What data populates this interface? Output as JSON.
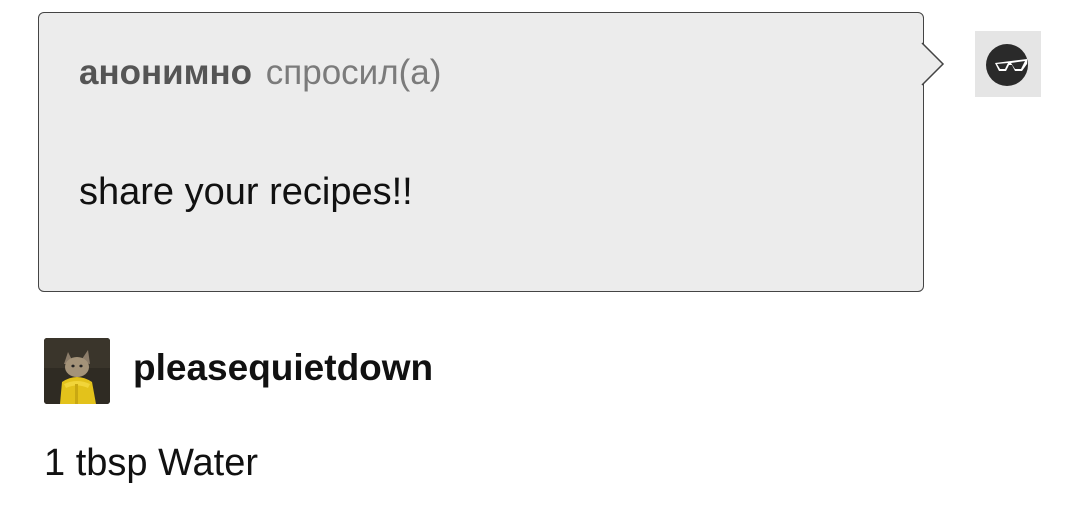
{
  "ask": {
    "asker": "анонимно",
    "verb": "спросил(а)",
    "question": "share your recipes!!",
    "anon_avatar_icon": "sunglasses-face-icon"
  },
  "answer": {
    "username": "pleasequietdown",
    "avatar_icon": "cat-in-raincoat-avatar",
    "body": "1 tbsp Water"
  },
  "colors": {
    "bubble_bg": "#ececec",
    "bubble_border": "#444444",
    "asker_name": "#555555",
    "verb_text": "#7b7b7b"
  }
}
